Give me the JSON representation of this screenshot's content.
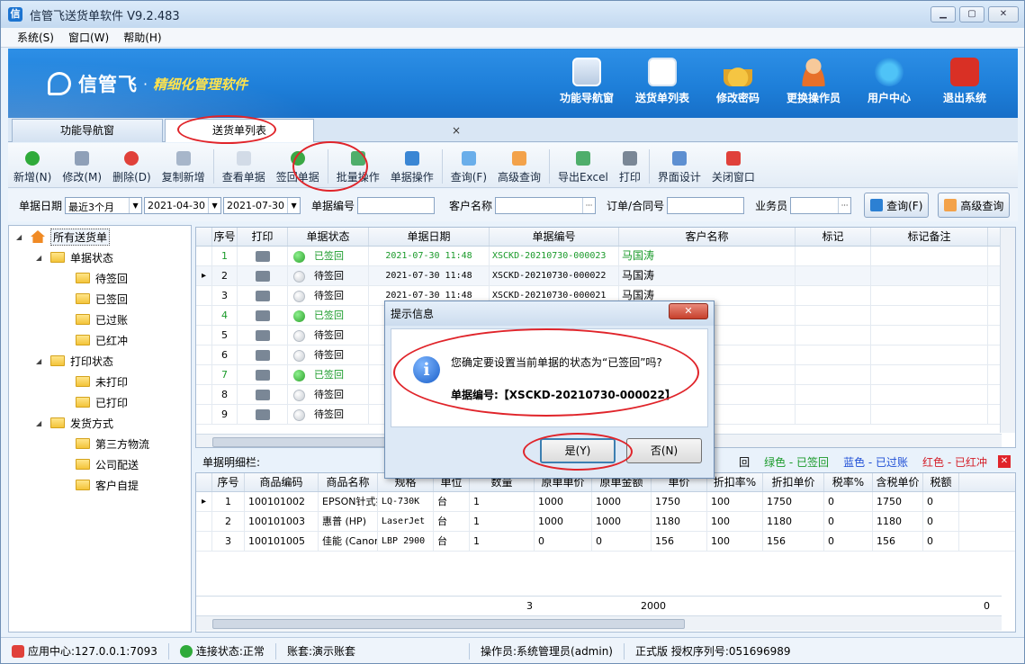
{
  "window": {
    "title": "信管飞送货单软件 V9.2.483",
    "app_icon_glyph": "信"
  },
  "menu": [
    "系统(S)",
    "窗口(W)",
    "帮助(H)"
  ],
  "banner": {
    "brand": "信管飞",
    "slogan": "精细化管理软件",
    "nav": [
      "功能导航窗",
      "送货单列表",
      "修改密码",
      "更换操作员",
      "用户中心",
      "退出系统"
    ]
  },
  "tabs": {
    "nav": "功能导航窗",
    "list": "送货单列表",
    "close_glyph": "×"
  },
  "toolbar": [
    "新增(N)",
    "修改(M)",
    "删除(D)",
    "复制新增",
    "查看单据",
    "签回单据",
    "批量操作",
    "单据操作",
    "查询(F)",
    "高级查询",
    "导出Excel",
    "打印",
    "界面设计",
    "关闭窗口"
  ],
  "filters": {
    "date_label": "单据日期",
    "range": "最近3个月",
    "from": "2021-04-30",
    "to": "2021-07-30",
    "doc_no_label": "单据编号",
    "customer_label": "客户名称",
    "order_label": "订单/合同号",
    "salesman_label": "业务员",
    "query_btn": "查询(F)",
    "adv_btn": "高级查询"
  },
  "tree": {
    "root": "所有送货单",
    "groups": [
      {
        "label": "单据状态",
        "items": [
          "待签回",
          "已签回",
          "已过账",
          "已红冲"
        ]
      },
      {
        "label": "打印状态",
        "items": [
          "未打印",
          "已打印"
        ]
      },
      {
        "label": "发货方式",
        "items": [
          "第三方物流",
          "公司配送",
          "客户自提"
        ]
      }
    ]
  },
  "main_grid": {
    "headers": [
      "序号",
      "打印",
      "单据状态",
      "单据日期",
      "单据编号",
      "客户名称",
      "标记",
      "标记备注"
    ],
    "rows": [
      {
        "no": "1",
        "status": "已签回",
        "signed": true,
        "date": "2021-07-30 11:48",
        "code": "XSCKD-20210730-000023",
        "customer": "马国涛"
      },
      {
        "no": "2",
        "status": "待签回",
        "signed": false,
        "date": "2021-07-30 11:48",
        "code": "XSCKD-20210730-000022",
        "customer": "马国涛",
        "current": true
      },
      {
        "no": "3",
        "status": "待签回",
        "signed": false,
        "date": "2021-07-30 11:48",
        "code": "XSCKD-20210730-000021",
        "customer": "马国涛"
      },
      {
        "no": "4",
        "status": "已签回",
        "signed": true,
        "date": "",
        "code": "",
        "customer": ""
      },
      {
        "no": "5",
        "status": "待签回",
        "signed": false,
        "date": "",
        "code": "",
        "customer": ""
      },
      {
        "no": "6",
        "status": "待签回",
        "signed": false,
        "date": "",
        "code": "",
        "customer": ""
      },
      {
        "no": "7",
        "status": "已签回",
        "signed": true,
        "date": "",
        "code": "",
        "customer": ""
      },
      {
        "no": "8",
        "status": "待签回",
        "signed": false,
        "date": "",
        "code": "",
        "customer": ""
      },
      {
        "no": "9",
        "status": "待签回",
        "signed": false,
        "date": "",
        "code": "",
        "customer": ""
      }
    ]
  },
  "detail": {
    "label": "单据明细栏:",
    "legend": [
      {
        "text": "绿色 - 已签回",
        "color": "#1a9a2a"
      },
      {
        "text": "蓝色 - 已过账",
        "color": "#1f4fd6"
      },
      {
        "text": "红色 - 已红冲",
        "color": "#d4202a"
      }
    ],
    "legend_prefix": "回",
    "headers": [
      "序号",
      "商品编码",
      "商品名称",
      "规格",
      "单位",
      "数量",
      "原单单价",
      "原单金额",
      "单价",
      "折扣率%",
      "折扣单价",
      "税率%",
      "含税单价",
      "税额"
    ],
    "rows": [
      [
        "1",
        "100101002",
        "EPSON针式打",
        "LQ-730K",
        "台",
        "1",
        "1000",
        "1000",
        "1750",
        "100",
        "1750",
        "0",
        "1750",
        "0"
      ],
      [
        "2",
        "100101003",
        "惠普 (HP)",
        "LaserJet",
        "台",
        "1",
        "1000",
        "1000",
        "1180",
        "100",
        "1180",
        "0",
        "1180",
        "0"
      ],
      [
        "3",
        "100101005",
        "佳能 (Canon",
        "LBP 2900",
        "台",
        "1",
        "0",
        "0",
        "156",
        "100",
        "156",
        "0",
        "156",
        "0"
      ]
    ],
    "totals": {
      "qty": "3",
      "amount": "2000",
      "tax": "0"
    }
  },
  "dialog": {
    "title": "提示信息",
    "message": "您确定要设置当前单据的状态为“已签回”吗?",
    "code_line": "单据编号:【XSCKD-20210730-000022】",
    "yes": "是(Y)",
    "no": "否(N)",
    "info_glyph": "i"
  },
  "status": {
    "app_center": "应用中心:127.0.0.1:7093",
    "conn": "连接状态:正常",
    "account": "账套:演示账套",
    "operator": "操作员:系统管理员(admin)",
    "license": "正式版 授权序列号:051696989"
  }
}
